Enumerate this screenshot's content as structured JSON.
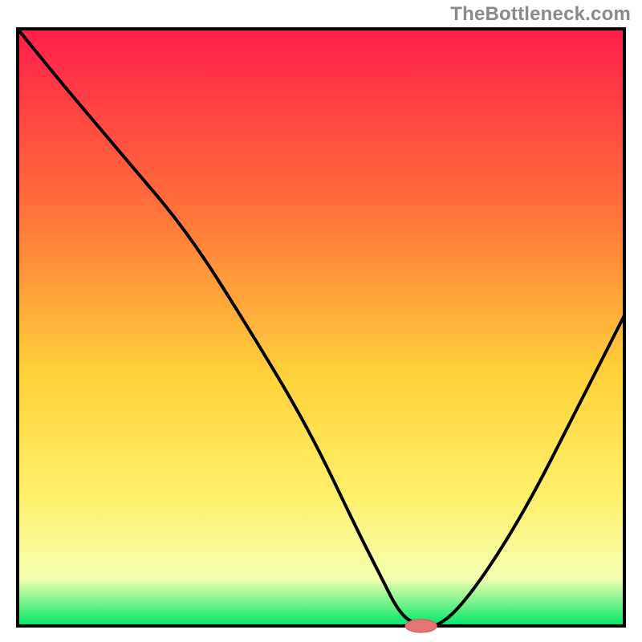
{
  "watermark": "TheBottleneck.com",
  "colors": {
    "gradient_top": "#ff1f4b",
    "gradient_mid1": "#ff6a3a",
    "gradient_mid2": "#ffd23a",
    "gradient_mid3": "#fff06a",
    "gradient_mid4": "#f5ffb0",
    "gradient_bottom": "#00e66a",
    "frame": "#000000",
    "curve": "#000000",
    "marker_fill": "#e57373",
    "marker_stroke": "#d45a5a"
  },
  "chart_data": {
    "type": "line",
    "title": "",
    "xlabel": "",
    "ylabel": "",
    "xlim": [
      0,
      100
    ],
    "ylim": [
      0,
      100
    ],
    "grid": false,
    "legend": false,
    "series": [
      {
        "name": "bottleneck-curve",
        "x": [
          0,
          8,
          18,
          28,
          38,
          48,
          56,
          60,
          63,
          66,
          70,
          76,
          84,
          92,
          100
        ],
        "y": [
          100,
          90,
          78,
          66,
          50,
          33,
          16,
          8,
          2,
          0,
          0,
          7,
          20,
          36,
          52
        ]
      }
    ],
    "marker": {
      "name": "optimal-point",
      "x": 66.5,
      "y": 0,
      "rx": 2.6,
      "ry": 1.1
    },
    "notes": "x is normalized component balance (0–100); y is bottleneck percentage (0 = green / no bottleneck, 100 = red / severe). Values estimated from pixel positions; no numeric axis labels present in the source image."
  }
}
